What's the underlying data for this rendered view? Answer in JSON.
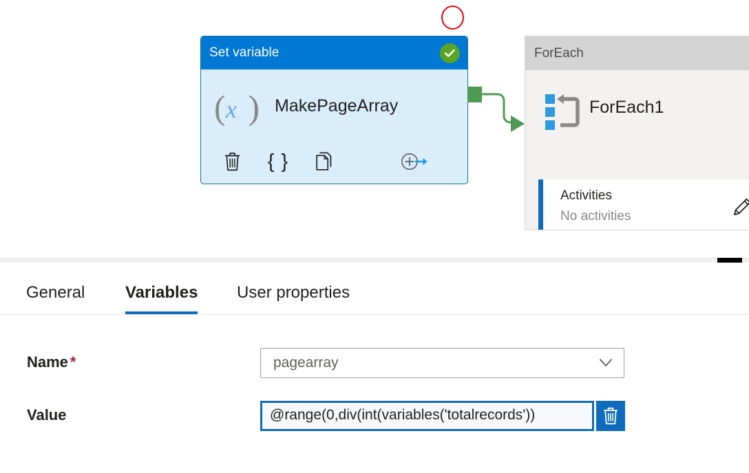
{
  "canvas": {
    "annotation": {
      "shape": "red-circle"
    },
    "set_variable_node": {
      "header_title": "Set variable",
      "status_icon": "check-circle-icon",
      "status_color": "#5ba524",
      "header_color": "#0078d4",
      "body_color": "#d9edfb",
      "variable_icon": "variable-x-icon",
      "paren_left": "(",
      "paren_right": ")",
      "x_glyph": "x",
      "activity_name": "MakePageArray",
      "actions": [
        {
          "name": "delete-activity",
          "icon": "trash-icon"
        },
        {
          "name": "view-code",
          "icon": "code-braces-icon",
          "glyph": "{ }"
        },
        {
          "name": "clone-activity",
          "icon": "copy-icon"
        },
        {
          "name": "add-output",
          "icon": "add-output-arrow-icon"
        }
      ]
    },
    "connector": {
      "color": "#4e9a51",
      "from": "Set variable",
      "to": "ForEach1"
    },
    "foreach_node": {
      "header_title": "ForEach",
      "icon": "foreach-loop-icon",
      "activity_name": "ForEach1",
      "activities_title": "Activities",
      "activities_status": "No activities",
      "edit_icon": "pencil-icon",
      "accent_color": "#0f6cbd"
    }
  },
  "properties_panel": {
    "tabs": [
      {
        "label": "General",
        "active": false
      },
      {
        "label": "Variables",
        "active": true
      },
      {
        "label": "User properties",
        "active": false
      }
    ],
    "fields": {
      "name": {
        "label": "Name",
        "required_marker": "*",
        "value": "pagearray",
        "chevron_icon": "chevron-down-icon"
      },
      "value": {
        "label": "Value",
        "value": "@range(0,div(int(variables('totalrecords'))",
        "delete_icon": "trash-icon",
        "delete_button_color": "#0f6cbd",
        "focus_color": "#0f6cbd"
      }
    }
  },
  "scrollbar": {
    "orientation": "horizontal",
    "thumb_color": "#000000"
  }
}
